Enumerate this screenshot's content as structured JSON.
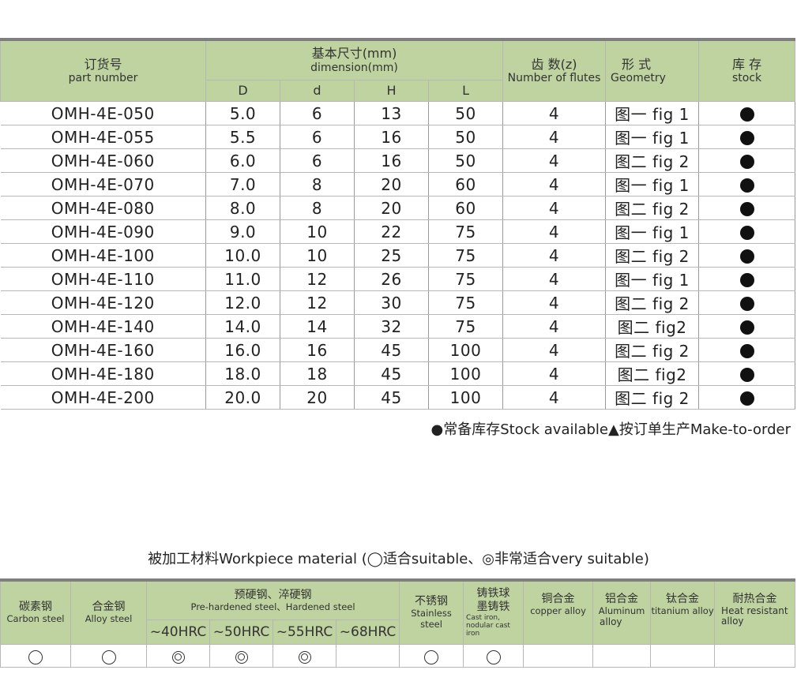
{
  "header": {
    "part_zh": "订货号",
    "part_en": "part number",
    "dim_zh": "基本尺寸(mm)",
    "dim_en": "dimension(mm)",
    "teeth_zh": "齿 数(z)",
    "teeth_en": "Number of flutes",
    "form_zh": "形 式",
    "form_en": "Geometry",
    "stock_zh": "库 存",
    "stock_en": "stock",
    "sub": [
      "D",
      "d",
      "H",
      "L"
    ]
  },
  "rows": [
    {
      "part": "OMH-4E-050",
      "D": "5.0",
      "d": "6",
      "H": "13",
      "L": "50",
      "z": "4",
      "fig": "图一 fig 1"
    },
    {
      "part": "OMH-4E-055",
      "D": "5.5",
      "d": "6",
      "H": "16",
      "L": "50",
      "z": "4",
      "fig": "图一 fig 1"
    },
    {
      "part": "OMH-4E-060",
      "D": "6.0",
      "d": "6",
      "H": "16",
      "L": "50",
      "z": "4",
      "fig": "图二 fig 2"
    },
    {
      "part": "OMH-4E-070",
      "D": "7.0",
      "d": "8",
      "H": "20",
      "L": "60",
      "z": "4",
      "fig": "图一 fig 1"
    },
    {
      "part": "OMH-4E-080",
      "D": "8.0",
      "d": "8",
      "H": "20",
      "L": "60",
      "z": "4",
      "fig": "图二 fig 2"
    },
    {
      "part": "OMH-4E-090",
      "D": "9.0",
      "d": "10",
      "H": "22",
      "L": "75",
      "z": "4",
      "fig": "图一 fig 1"
    },
    {
      "part": "OMH-4E-100",
      "D": "10.0",
      "d": "10",
      "H": "25",
      "L": "75",
      "z": "4",
      "fig": "图二 fig 2"
    },
    {
      "part": "OMH-4E-110",
      "D": "11.0",
      "d": "12",
      "H": "26",
      "L": "75",
      "z": "4",
      "fig": "图一 fig 1"
    },
    {
      "part": "OMH-4E-120",
      "D": "12.0",
      "d": "12",
      "H": "30",
      "L": "75",
      "z": "4",
      "fig": "图二 fig 2"
    },
    {
      "part": "OMH-4E-140",
      "D": "14.0",
      "d": "14",
      "H": "32",
      "L": "75",
      "z": "4",
      "fig": "图二  fig2"
    },
    {
      "part": "OMH-4E-160",
      "D": "16.0",
      "d": "16",
      "H": "45",
      "L": "100",
      "z": "4",
      "fig": "图二 fig 2"
    },
    {
      "part": "OMH-4E-180",
      "D": "18.0",
      "d": "18",
      "H": "45",
      "L": "100",
      "z": "4",
      "fig": "图二  fig2"
    },
    {
      "part": "OMH-4E-200",
      "D": "20.0",
      "d": "20",
      "H": "45",
      "L": "100",
      "z": "4",
      "fig": "图二 fig 2"
    }
  ],
  "legend": "●常备库存Stock available▲按订单生产Make-to-order",
  "material": {
    "title": "被加工材料Workpiece material (◯适合suitable、◎非常适合very suitable)",
    "carbon_zh": "碳素钢",
    "carbon_en": "Carbon steel",
    "alloy_zh": "合金钢",
    "alloy_en": "Alloy steel",
    "hard_zh": "预硬钢、淬硬钢",
    "hard_en": "Pre-hardened steel、Hardened steel",
    "hrc": [
      "~40HRC",
      "~50HRC",
      "~55HRC",
      "~68HRC"
    ],
    "stainless_zh": "不锈钢",
    "stainless_en": "Stainless steel",
    "cast_zh1": "铸铁球",
    "cast_zh2": "墨铸铁",
    "cast_en1": "Cast iron,",
    "cast_en2": "nodular cast iron",
    "copper_zh": "铜合金",
    "copper_en": "copper alloy",
    "alu_zh": "铝合金",
    "alu_en1": "Aluminum",
    "alu_en2": "alloy",
    "ti_zh": "钛合金",
    "ti_en": "titanium alloy",
    "heat_zh": "耐热合金",
    "heat_en1": "Heat resistant",
    "heat_en2": "alloy",
    "suitability": [
      "suitable",
      "suitable",
      "very suitable",
      "very suitable",
      "very suitable",
      "",
      "suitable",
      "suitable",
      "",
      "",
      "",
      ""
    ]
  }
}
